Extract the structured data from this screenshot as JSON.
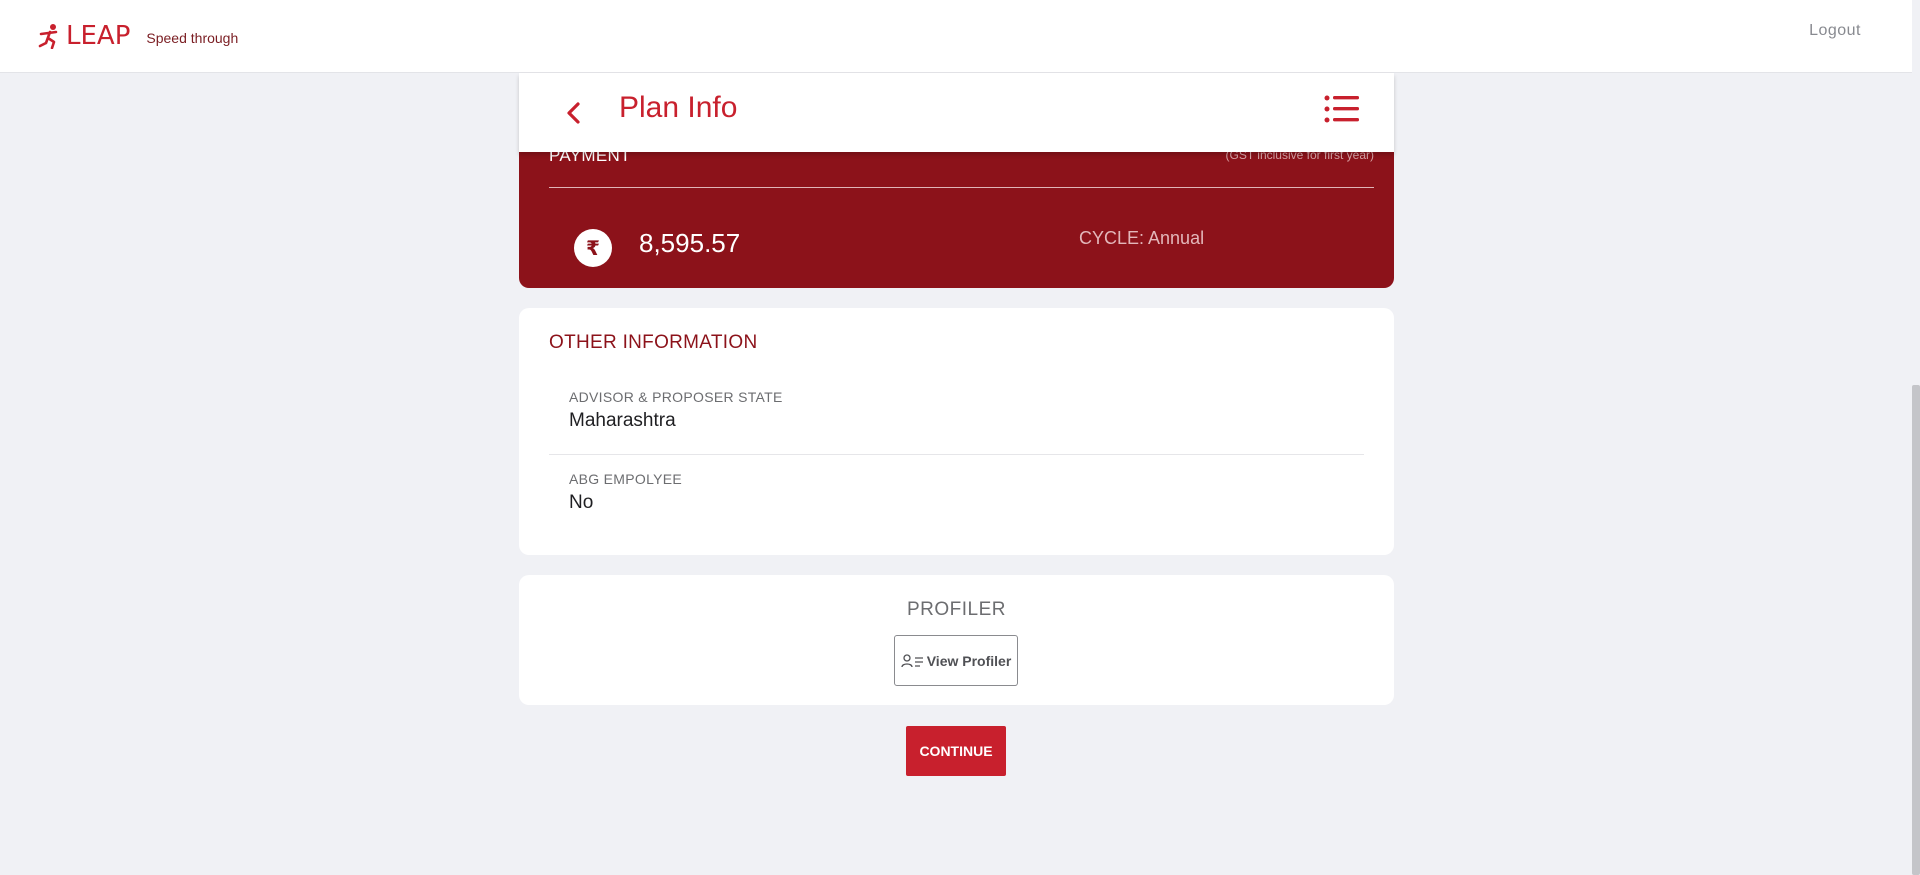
{
  "header": {
    "brand_name": "LEAP",
    "tagline": "Speed through",
    "logout_label": "Logout",
    "brand_color": "#c8202d"
  },
  "plan_header": {
    "title": "Plan Info",
    "back_icon": "chevron-left-icon",
    "menu_icon": "list-menu-icon"
  },
  "payment": {
    "title": "PAYMENT",
    "gst_note": "(GST inclusive for first year)",
    "currency_icon": "rupee-icon",
    "currency_symbol": "₹",
    "amount": "8,595.57",
    "cycle": "CYCLE: Annual",
    "card_color": "#8c121a"
  },
  "other_information": {
    "title": "OTHER INFORMATION",
    "fields": [
      {
        "label": "ADVISOR & PROPOSER STATE",
        "value": "Maharashtra"
      },
      {
        "label": "ABG EMPOLYEE",
        "value": "No"
      }
    ]
  },
  "profiler": {
    "title": "PROFILER",
    "button_label": "View Profiler",
    "button_icon": "user-list-icon"
  },
  "continue_label": "CONTINUE"
}
